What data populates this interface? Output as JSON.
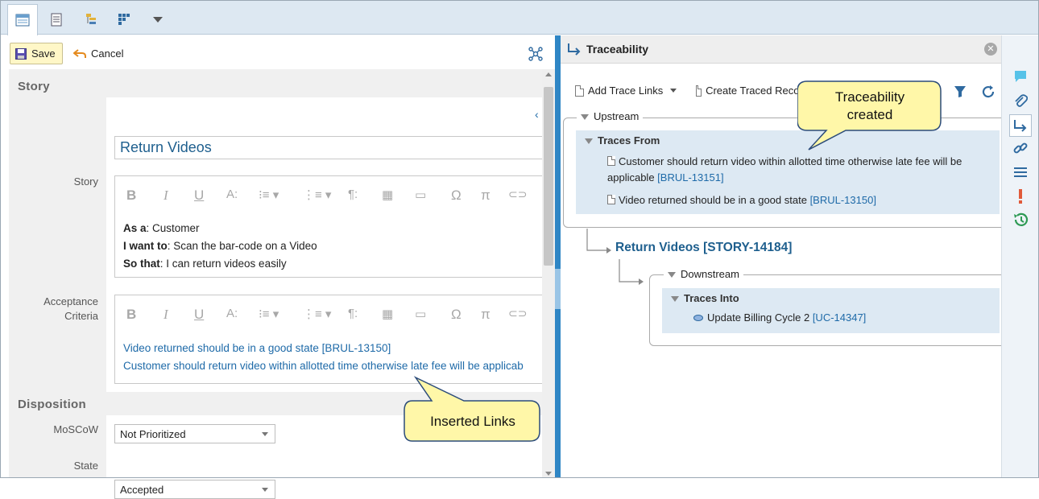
{
  "toolbar": {
    "save_label": "Save",
    "cancel_label": "Cancel"
  },
  "story_section": {
    "title": "Story",
    "name_value": "Return Videos",
    "story_label": "Story",
    "story_body": [
      {
        "bold": "As a",
        "rest": ": Customer"
      },
      {
        "bold": "I want to",
        "rest": ": Scan the bar-code on a Video"
      },
      {
        "bold": "So that",
        "rest": ": I can return videos easily"
      }
    ],
    "acceptance_label_1": "Acceptance",
    "acceptance_label_2": "Criteria",
    "acceptance_links": [
      "Video returned should be in a good state [BRUL-13150]",
      "Customer should return video within allotted time otherwise late fee will be applicab"
    ]
  },
  "disposition_section": {
    "title": "Disposition",
    "moscow_label": "MoSCoW",
    "moscow_value": "Not Prioritized",
    "state_label": "State",
    "state_value": "Accepted"
  },
  "rte_toolbar": [
    "B",
    "I",
    "U",
    "A:",
    "Ω",
    "π"
  ],
  "traceability": {
    "title": "Traceability",
    "add_trace_links": "Add Trace Links",
    "create_traced_record": "Create Traced Record",
    "upstream": "Upstream",
    "traces_from": "Traces From",
    "upstream_items": [
      {
        "text": "Customer should return video within allotted time otherwise late fee will be",
        "text2": "applicable",
        "id": "[BRUL-13151]"
      },
      {
        "text": "Video returned should be in a good state",
        "text2": "",
        "id": "[BRUL-13150]"
      }
    ],
    "current_item": "Return Videos [STORY-14184]",
    "downstream": "Downstream",
    "traces_into": "Traces Into",
    "downstream_items": [
      {
        "text": "Update Billing Cycle 2",
        "id": "[UC-14347]"
      }
    ]
  },
  "callouts": {
    "traceability_line1": "Traceability",
    "traceability_line2": "created",
    "inserted_links": "Inserted Links"
  },
  "colors": {
    "accent": "#2f86c5",
    "link": "#1e6aa8",
    "title_blue": "#1e5f8e",
    "callout_fill": "#fff7a8",
    "callout_border": "#2c4c7a"
  }
}
